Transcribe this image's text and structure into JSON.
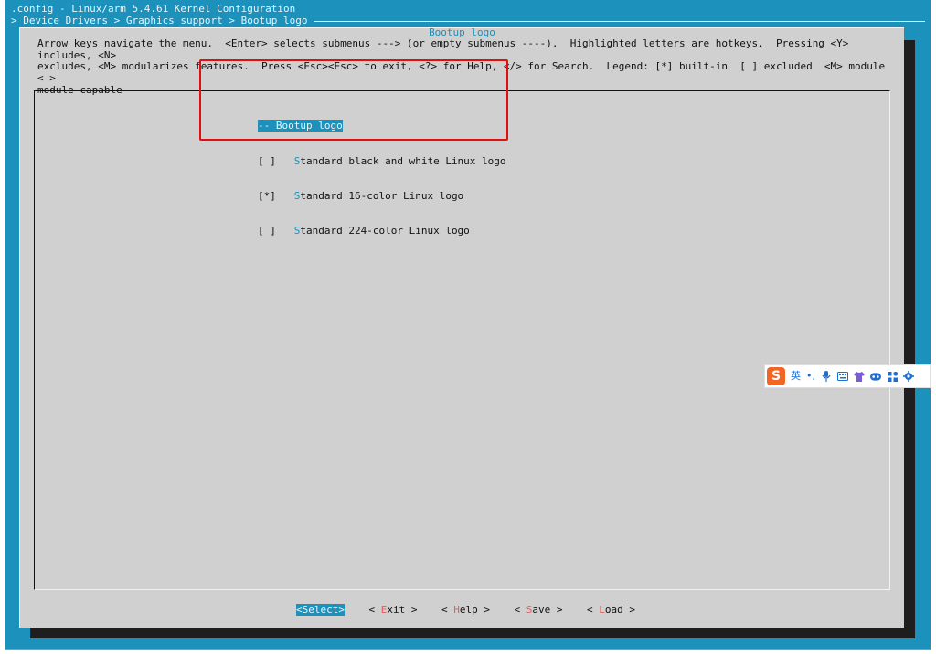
{
  "window": {
    "title": ".config - Linux/arm 5.4.61 Kernel Configuration",
    "breadcrumb": "> Device Drivers > Graphics support > Bootup logo"
  },
  "dialog": {
    "title": "Bootup logo",
    "help_text": "Arrow keys navigate the menu.  <Enter> selects submenus ---> (or empty submenus ----).  Highlighted letters are hotkeys.  Pressing <Y> includes, <N>\nexcludes, <M> modularizes features.  Press <Esc><Esc> to exit, <?> for Help, </> for Search.  Legend: [*] built-in  [ ] excluded  <M> module  < >\nmodule capable"
  },
  "menu": {
    "header": {
      "prefix": "-",
      "text": "- Bootup logo"
    },
    "items": [
      {
        "mark": "[ ]",
        "hotkey": "S",
        "rest": "tandard black and white Linux logo"
      },
      {
        "mark": "[*]",
        "hotkey": "S",
        "rest": "tandard 16-color Linux logo"
      },
      {
        "mark": "[ ]",
        "hotkey": "S",
        "rest": "tandard 224-color Linux logo"
      }
    ]
  },
  "buttons": {
    "select": "<Select>",
    "exit": {
      "pre": "< ",
      "hot": "E",
      "rest": "xit >"
    },
    "help": {
      "pre": "< ",
      "hot": "H",
      "rest": "elp >"
    },
    "save": {
      "pre": "< ",
      "hot": "S",
      "rest": "ave >"
    },
    "load": {
      "pre": "< ",
      "hot": "L",
      "rest": "oad >"
    }
  },
  "ime": {
    "logo": "S",
    "mode": "英",
    "punct": "•,"
  },
  "colors": {
    "accent": "#1b91bb",
    "dialog_bg": "#d0d0d0",
    "annotation": "#e01010",
    "ime_brand": "#f26522"
  }
}
